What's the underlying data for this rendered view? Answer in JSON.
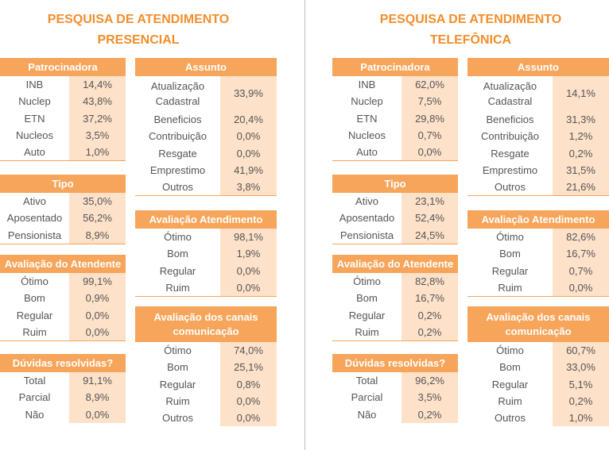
{
  "presencial": {
    "title1": "PESQUISA DE ATENDIMENTO",
    "title2": "PRESENCIAL",
    "patrocinadora": {
      "header": "Patrocinadora",
      "rows": [
        {
          "label": "INB",
          "value": "14,4%"
        },
        {
          "label": "Nuclep",
          "value": "43,8%"
        },
        {
          "label": "ETN",
          "value": "37,2%"
        },
        {
          "label": "Nucleos",
          "value": "3,5%"
        },
        {
          "label": "Auto",
          "value": "1,0%"
        }
      ]
    },
    "tipo": {
      "header": "Tipo",
      "rows": [
        {
          "label": "Ativo",
          "value": "35,0%"
        },
        {
          "label": "Aposentado",
          "value": "56,2%"
        },
        {
          "label": "Pensionista",
          "value": "8,9%"
        }
      ]
    },
    "atendente": {
      "header": "Avaliação do Atendente",
      "rows": [
        {
          "label": "Ótimo",
          "value": "99,1%"
        },
        {
          "label": "Bom",
          "value": "0,9%"
        },
        {
          "label": "Regular",
          "value": "0,0%"
        },
        {
          "label": "Ruim",
          "value": "0,0%"
        }
      ]
    },
    "duvidas": {
      "header": "Dúvidas resolvidas?",
      "rows": [
        {
          "label": "Total",
          "value": "91,1%"
        },
        {
          "label": "Parcial",
          "value": "8,9%"
        },
        {
          "label": "Não",
          "value": "0,0%"
        }
      ]
    },
    "assunto": {
      "header": "Assunto",
      "rows": [
        {
          "label": "Atualização Cadastral",
          "value": "33,9%"
        },
        {
          "label": "Beneficios",
          "value": "20,4%"
        },
        {
          "label": "Contribuição",
          "value": "0,0%"
        },
        {
          "label": "Resgate",
          "value": "0,0%"
        },
        {
          "label": "Emprestimo",
          "value": "41,9%"
        },
        {
          "label": "Outros",
          "value": "3,8%"
        }
      ]
    },
    "atendimento": {
      "header": "Avaliação Atendimento",
      "rows": [
        {
          "label": "Ótimo",
          "value": "98,1%"
        },
        {
          "label": "Bom",
          "value": "1,9%"
        },
        {
          "label": "Regular",
          "value": "0,0%"
        },
        {
          "label": "Ruim",
          "value": "0,0%"
        }
      ]
    },
    "canais": {
      "header": "Avaliação dos canais comunicação",
      "rows": [
        {
          "label": "Ótimo",
          "value": "74,0%"
        },
        {
          "label": "Bom",
          "value": "25,1%"
        },
        {
          "label": "Regular",
          "value": "0,8%"
        },
        {
          "label": "Ruim",
          "value": "0,0%"
        },
        {
          "label": "Outros",
          "value": "0,0%"
        }
      ]
    }
  },
  "telefonica": {
    "title1": "PESQUISA DE ATENDIMENTO",
    "title2": "TELEFÔNICA",
    "patrocinadora": {
      "header": "Patrocinadora",
      "rows": [
        {
          "label": "INB",
          "value": "62,0%"
        },
        {
          "label": "Nuclep",
          "value": "7,5%"
        },
        {
          "label": "ETN",
          "value": "29,8%"
        },
        {
          "label": "Nucleos",
          "value": "0,7%"
        },
        {
          "label": "Auto",
          "value": "0,0%"
        }
      ]
    },
    "tipo": {
      "header": "Tipo",
      "rows": [
        {
          "label": "Ativo",
          "value": "23,1%"
        },
        {
          "label": "Aposentado",
          "value": "52,4%"
        },
        {
          "label": "Pensionista",
          "value": "24,5%"
        }
      ]
    },
    "atendente": {
      "header": "Avaliação do Atendente",
      "rows": [
        {
          "label": "Ótimo",
          "value": "82,8%"
        },
        {
          "label": "Bom",
          "value": "16,7%"
        },
        {
          "label": "Regular",
          "value": "0,2%"
        },
        {
          "label": "Ruim",
          "value": "0,2%"
        }
      ]
    },
    "duvidas": {
      "header": "Dúvidas resolvidas?",
      "rows": [
        {
          "label": "Total",
          "value": "96,2%"
        },
        {
          "label": "Parcial",
          "value": "3,5%"
        },
        {
          "label": "Não",
          "value": "0,2%"
        }
      ]
    },
    "assunto": {
      "header": "Assunto",
      "rows": [
        {
          "label": "Atualização Cadastral",
          "value": "14,1%"
        },
        {
          "label": "Beneficios",
          "value": "31,3%"
        },
        {
          "label": "Contribuição",
          "value": "1,2%"
        },
        {
          "label": "Resgate",
          "value": "0,2%"
        },
        {
          "label": "Emprestimo",
          "value": "31,5%"
        },
        {
          "label": "Outros",
          "value": "21,6%"
        }
      ]
    },
    "atendimento": {
      "header": "Avaliação Atendimento",
      "rows": [
        {
          "label": "Ótimo",
          "value": "82,6%"
        },
        {
          "label": "Bom",
          "value": "16,7%"
        },
        {
          "label": "Regular",
          "value": "0,7%"
        },
        {
          "label": "Ruim",
          "value": "0,0%"
        }
      ]
    },
    "canais": {
      "header": "Avaliação dos canais comunicação",
      "rows": [
        {
          "label": "Ótimo",
          "value": "60,7%"
        },
        {
          "label": "Bom",
          "value": "33,0%"
        },
        {
          "label": "Regular",
          "value": "5,1%"
        },
        {
          "label": "Ruim",
          "value": "0,2%"
        },
        {
          "label": "Outros",
          "value": "1,0%"
        }
      ]
    }
  }
}
